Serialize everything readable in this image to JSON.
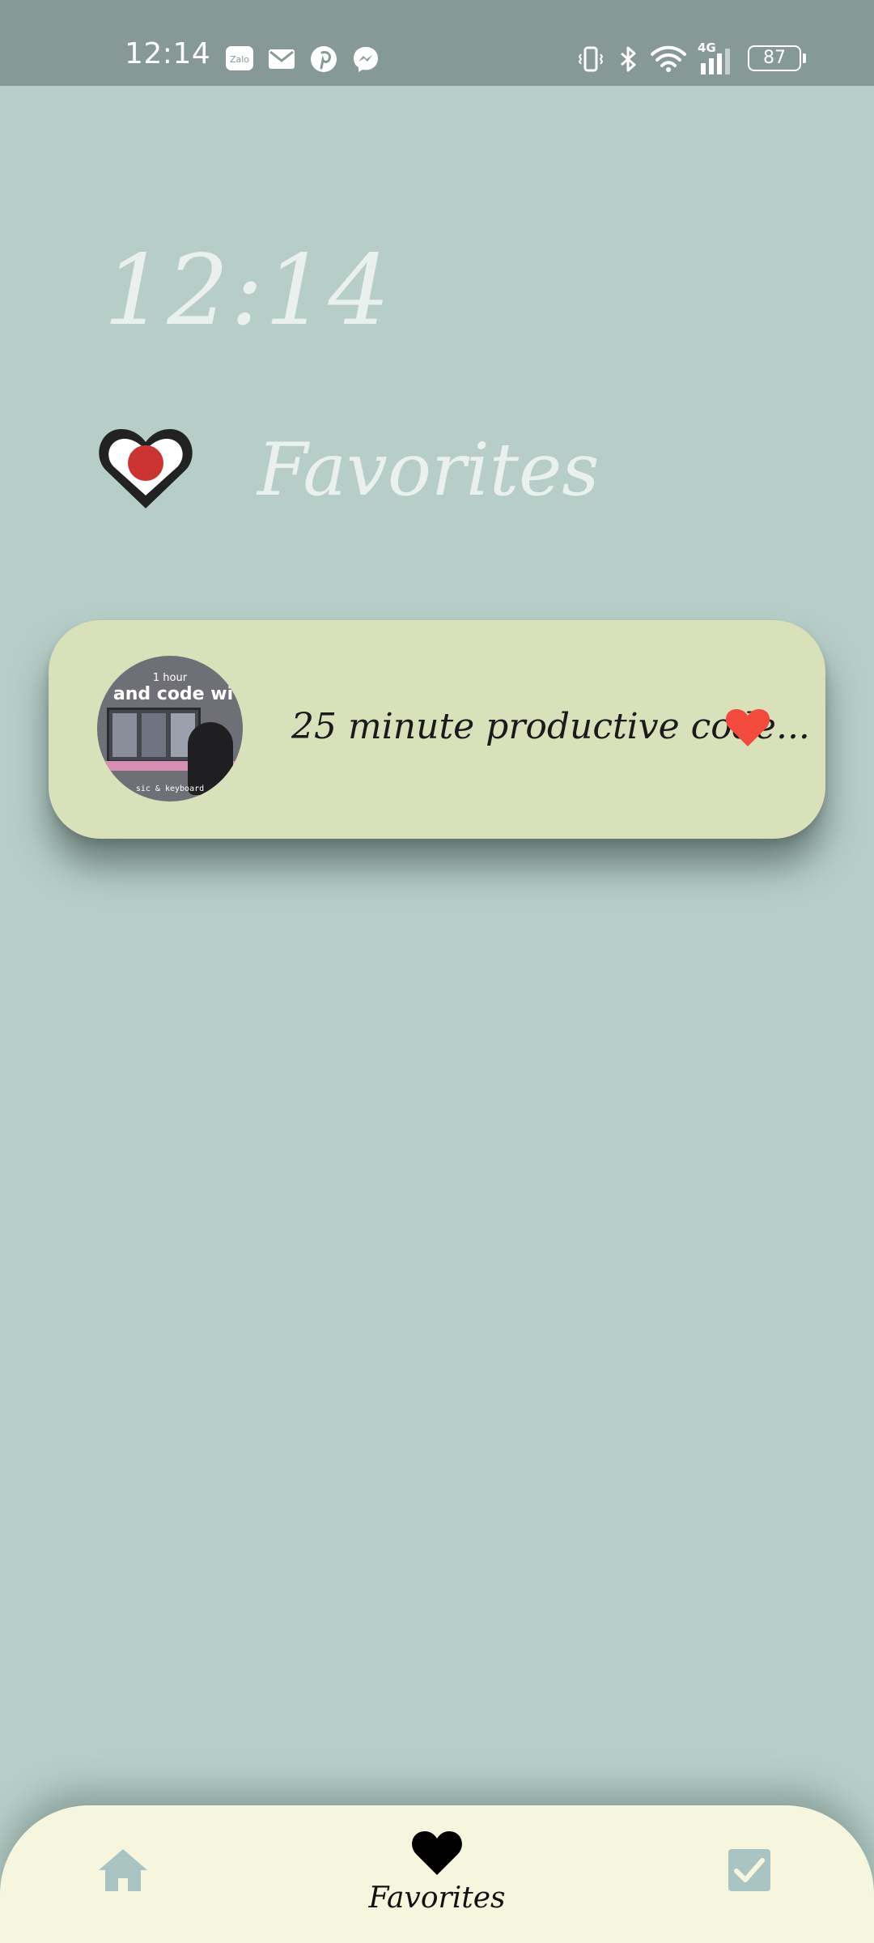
{
  "status_bar": {
    "time": "12:14",
    "notification_icons": [
      "zalo-icon",
      "mail-icon",
      "pinterest-icon",
      "messenger-icon"
    ],
    "zalo_label": "Zalo",
    "system_icons": [
      "vibrate-icon",
      "bluetooth-icon",
      "wifi-icon",
      "signal-4g-icon"
    ],
    "network_label": "4G",
    "battery": "87"
  },
  "clock": {
    "time": "12:14"
  },
  "header": {
    "title": "Favorites",
    "icon": "heart-record-icon"
  },
  "favorites": [
    {
      "title": "25 minute productive code...",
      "thumbnail_text_top": "1 hour",
      "thumbnail_text_main": "y and code wi",
      "thumbnail_caption": "sic & keyboard",
      "favorited": true,
      "heart_color": "#f24a3c"
    }
  ],
  "bottom_nav": {
    "items": [
      {
        "id": "home",
        "icon": "home-icon",
        "label": ""
      },
      {
        "id": "favorites",
        "icon": "heart-icon",
        "label": "Favorites"
      },
      {
        "id": "tasks",
        "icon": "checkbox-icon",
        "label": ""
      }
    ],
    "active": "favorites"
  },
  "colors": {
    "background": "#b7cec8",
    "status_bar": "#879996",
    "card": "#d9e1bb",
    "nav": "#f6f6de",
    "nav_inactive_icon": "#a9c4c2",
    "accent_red": "#f24a3c"
  }
}
